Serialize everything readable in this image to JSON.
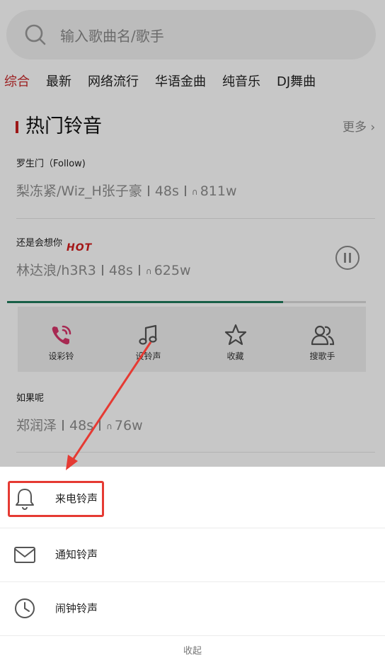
{
  "search": {
    "placeholder": "输入歌曲名/歌手"
  },
  "tabs": [
    {
      "label": "综合",
      "active": true
    },
    {
      "label": "最新"
    },
    {
      "label": "网络流行"
    },
    {
      "label": "华语金曲"
    },
    {
      "label": "纯音乐"
    },
    {
      "label": "DJ舞曲"
    }
  ],
  "section": {
    "title": "热门铃音",
    "more": "更多 ›"
  },
  "songs": [
    {
      "title": "罗生门（Follow)",
      "artist": "梨冻紧/Wiz_H张子豪",
      "duration": "48s",
      "plays": "811w"
    },
    {
      "title": "还是会想你",
      "badge": "HOT",
      "artist": "林达浪/h3R3",
      "duration": "48s",
      "plays": "625w",
      "playing": true,
      "progress_percent": 77
    },
    {
      "title": "如果呢",
      "artist": "郑润泽",
      "duration": "48s",
      "plays": "76w"
    }
  ],
  "actions": [
    {
      "label": "设彩铃",
      "icon": "phone-ring-icon",
      "color": "#d7356a"
    },
    {
      "label": "设铃声",
      "icon": "music-note-icon",
      "color": "#555555"
    },
    {
      "label": "收藏",
      "icon": "star-icon",
      "color": "#555555"
    },
    {
      "label": "搜歌手",
      "icon": "users-icon",
      "color": "#555555"
    }
  ],
  "sheet": {
    "items": [
      {
        "label": "来电铃声",
        "icon": "bell-icon",
        "highlighted": true
      },
      {
        "label": "通知铃声",
        "icon": "envelope-icon"
      },
      {
        "label": "闹钟铃声",
        "icon": "clock-icon"
      }
    ],
    "collapse": "收起"
  },
  "colors": {
    "accent_red": "#c8282a",
    "progress": "#1f7a5c",
    "annotation": "#e53a33"
  }
}
